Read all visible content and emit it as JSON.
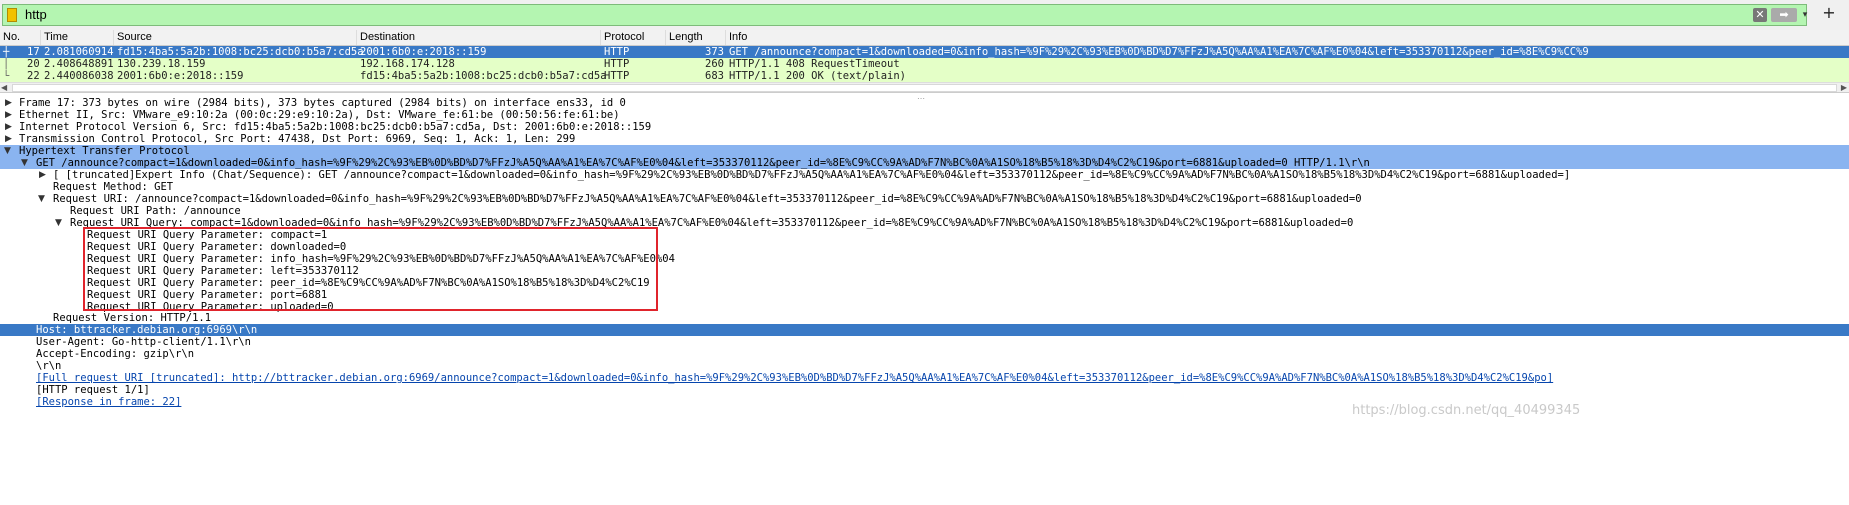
{
  "filter": {
    "value": "http",
    "clear_label": "✕",
    "apply_label": "➡",
    "dropdown_label": "▾",
    "add_label": "+"
  },
  "packet_list": {
    "columns": [
      "No.",
      "Time",
      "Source",
      "Destination",
      "Protocol",
      "Length",
      "Info"
    ],
    "rows": [
      {
        "no": "17",
        "time": "2.081060914",
        "source": "fd15:4ba5:5a2b:1008:bc25:dcb0:b5a7:cd5a",
        "destination": "2001:6b0:e:2018::159",
        "protocol": "HTTP",
        "length": "373",
        "info": "GET /announce?compact=1&downloaded=0&info_hash=%9F%29%2C%93%EB%0D%BD%D7%FFzJ%A5Q%AA%A1%EA%7C%AF%E0%04&left=353370112&peer_id=%8E%C9%CC%9"
      },
      {
        "no": "20",
        "time": "2.408648891",
        "source": "130.239.18.159",
        "destination": "192.168.174.128",
        "protocol": "HTTP",
        "length": "260",
        "info": "HTTP/1.1 408 RequestTimeout"
      },
      {
        "no": "22",
        "time": "2.440086038",
        "source": "2001:6b0:e:2018::159",
        "destination": "fd15:4ba5:5a2b:1008:bc25:dcb0:b5a7:cd5a",
        "protocol": "HTTP",
        "length": "683",
        "info": "HTTP/1.1 200 OK  (text/plain)"
      }
    ]
  },
  "details": {
    "frame": "Frame 17: 373 bytes on wire (2984 bits), 373 bytes captured (2984 bits) on interface ens33, id 0",
    "ethernet": "Ethernet II, Src: VMware_e9:10:2a (00:0c:29:e9:10:2a), Dst: VMware_fe:61:be (00:50:56:fe:61:be)",
    "ipv6": "Internet Protocol Version 6, Src: fd15:4ba5:5a2b:1008:bc25:dcb0:b5a7:cd5a, Dst: 2001:6b0:e:2018::159",
    "tcp": "Transmission Control Protocol, Src Port: 47438, Dst Port: 6969, Seq: 1, Ack: 1, Len: 299",
    "http": "Hypertext Transfer Protocol",
    "get_line": "GET /announce?compact=1&downloaded=0&info_hash=%9F%29%2C%93%EB%0D%BD%D7%FFzJ%A5Q%AA%A1%EA%7C%AF%E0%04&left=353370112&peer_id=%8E%C9%CC%9A%AD%F7N%BC%0A%A1SO%18%B5%18%3D%D4%C2%C19&port=6881&uploaded=0 HTTP/1.1\\r\\n",
    "expert_info": "[ [truncated]Expert Info (Chat/Sequence): GET /announce?compact=1&downloaded=0&info_hash=%9F%29%2C%93%EB%0D%BD%D7%FFzJ%A5Q%AA%A1%EA%7C%AF%E0%04&left=353370112&peer_id=%8E%C9%CC%9A%AD%F7N%BC%0A%A1SO%18%B5%18%3D%D4%C2%C19&port=6881&uploaded=]",
    "request_method": "Request Method: GET",
    "request_uri": "Request URI: /announce?compact=1&downloaded=0&info_hash=%9F%29%2C%93%EB%0D%BD%D7%FFzJ%A5Q%AA%A1%EA%7C%AF%E0%04&left=353370112&peer_id=%8E%C9%CC%9A%AD%F7N%BC%0A%A1SO%18%B5%18%3D%D4%C2%C19&port=6881&uploaded=0",
    "request_uri_path": "Request URI Path: /announce",
    "request_uri_query": "Request URI Query: compact=1&downloaded=0&info_hash=%9F%29%2C%93%EB%0D%BD%D7%FFzJ%A5Q%AA%A1%EA%7C%AF%E0%04&left=353370112&peer_id=%8E%C9%CC%9A%AD%F7N%BC%0A%A1SO%18%B5%18%3D%D4%C2%C19&port=6881&uploaded=0",
    "query_params": [
      "Request URI Query Parameter: compact=1",
      "Request URI Query Parameter: downloaded=0",
      "Request URI Query Parameter: info_hash=%9F%29%2C%93%EB%0D%BD%D7%FFzJ%A5Q%AA%A1%EA%7C%AF%E0%04",
      "Request URI Query Parameter: left=353370112",
      "Request URI Query Parameter: peer_id=%8E%C9%CC%9A%AD%F7N%BC%0A%A1SO%18%B5%18%3D%D4%C2%C19",
      "Request URI Query Parameter: port=6881",
      "Request URI Query Parameter: uploaded=0"
    ],
    "request_version": "Request Version: HTTP/1.1",
    "host": "Host: bttracker.debian.org:6969\\r\\n",
    "user_agent": "User-Agent: Go-http-client/1.1\\r\\n",
    "accept_encoding": "Accept-Encoding: gzip\\r\\n",
    "crlf": "\\r\\n",
    "full_request_uri": "[Full request URI [truncated]: http://bttracker.debian.org:6969/announce?compact=1&downloaded=0&info_hash=%9F%29%2C%93%EB%0D%BD%D7%FFzJ%A5Q%AA%A1%EA%7C%AF%E0%04&left=353370112&peer_id=%8E%C9%CC%9A%AD%F7N%BC%0A%A1SO%18%B5%18%3D%D4%C2%C19&po]",
    "http_request": "[HTTP request 1/1]",
    "response_in_frame": "[Response in frame: 22]"
  },
  "watermark": "https://blog.csdn.net/qq_40499345",
  "colors": {
    "filter_bg": "#b4f5b1",
    "selected_row": "#3979c6",
    "http_row": "#e4ffc7",
    "tree_highlight": "#8ab4f0",
    "highlight_box": "#e0242c"
  }
}
